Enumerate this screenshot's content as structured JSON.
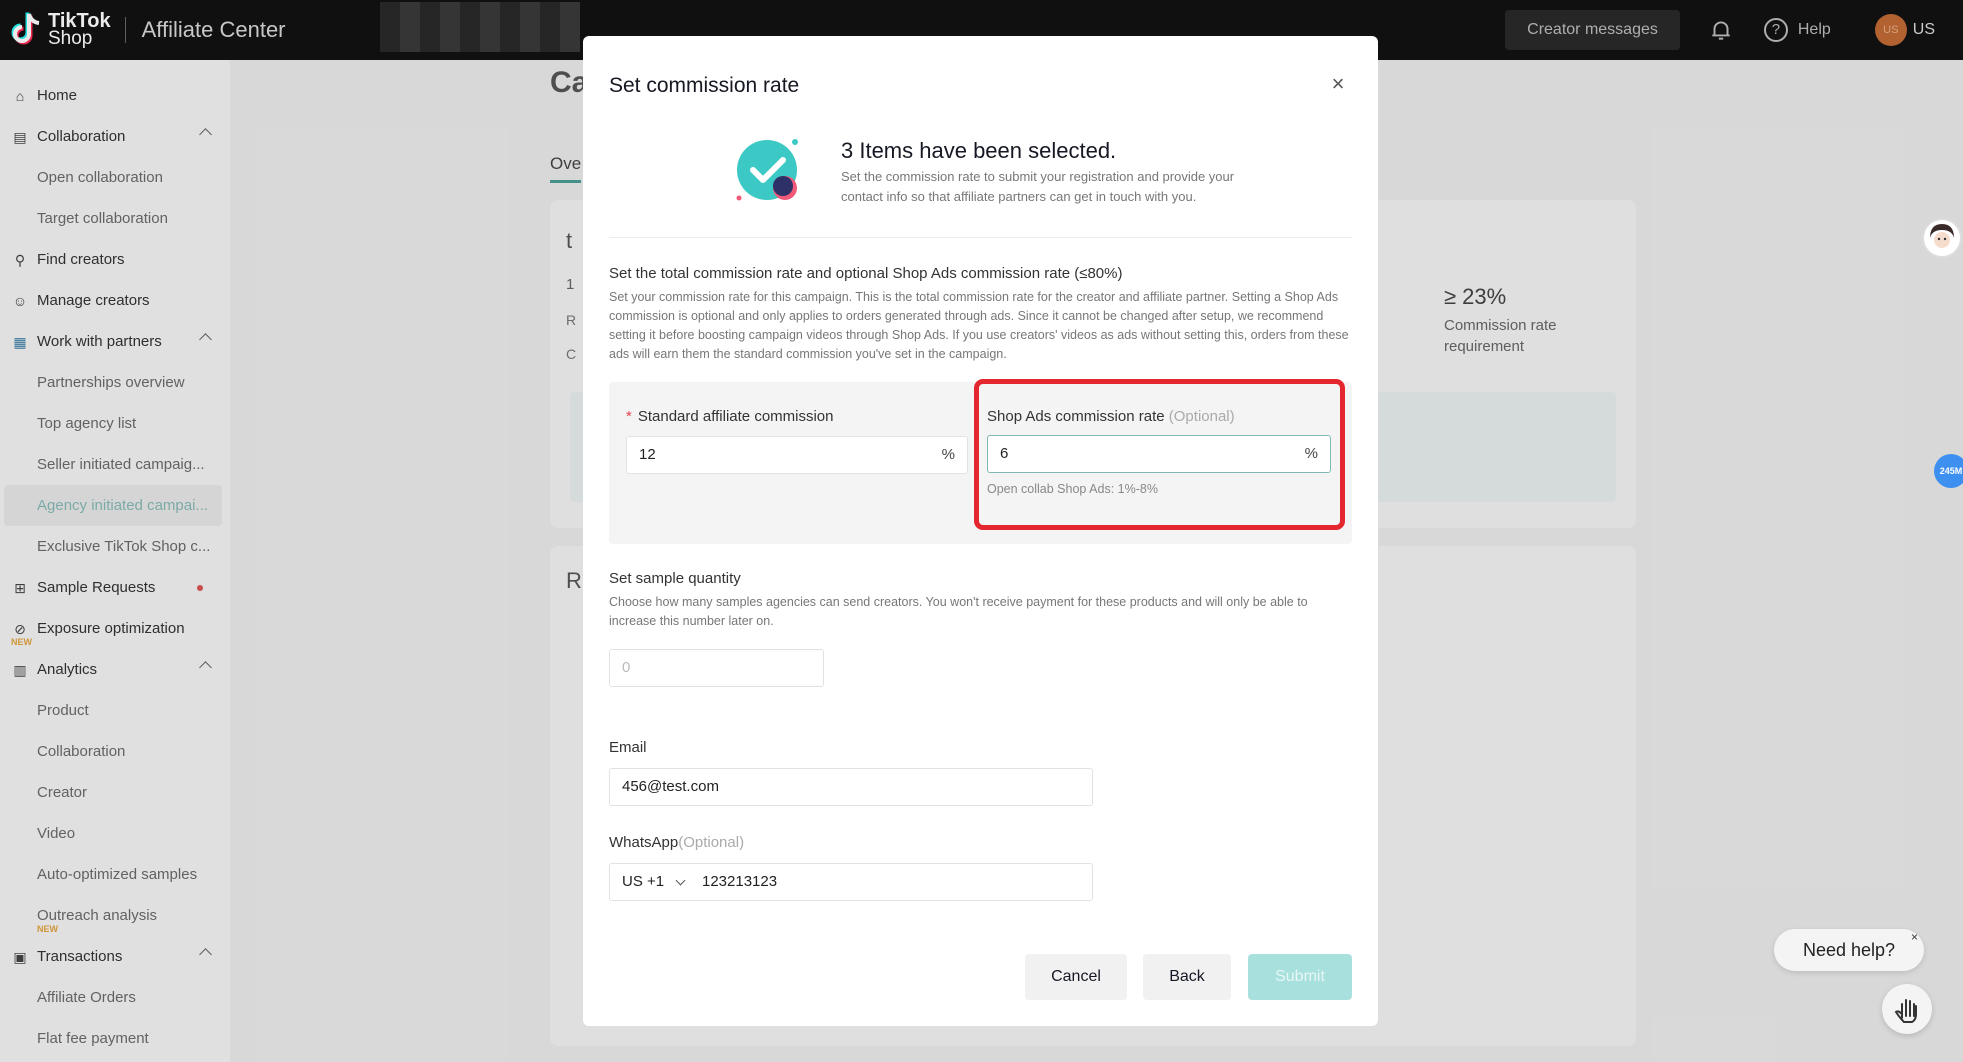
{
  "topbar": {
    "logo_line1": "TikTok",
    "logo_line2": "Shop",
    "app_title": "Affiliate Center",
    "creator_messages": "Creator messages",
    "help": "Help",
    "user_region": "US",
    "avatar_text": "US"
  },
  "sidebar": {
    "home": "Home",
    "collaboration": "Collaboration",
    "open_collaboration": "Open collaboration",
    "target_collaboration": "Target collaboration",
    "find_creators": "Find creators",
    "manage_creators": "Manage creators",
    "work_with_partners": "Work with partners",
    "partnerships_overview": "Partnerships overview",
    "top_agency_list": "Top agency list",
    "seller_initiated": "Seller initiated campaig...",
    "agency_initiated": "Agency initiated campai...",
    "exclusive_tiktok": "Exclusive TikTok Shop c...",
    "sample_requests": "Sample Requests",
    "exposure_optimization": "Exposure optimization",
    "new_badge": "NEW",
    "analytics": "Analytics",
    "product": "Product",
    "collaboration_an": "Collaboration",
    "creator": "Creator",
    "video": "Video",
    "auto_optimized": "Auto-optimized samples",
    "outreach_analysis": "Outreach analysis",
    "transactions": "Transactions",
    "affiliate_orders": "Affiliate Orders",
    "flat_fee_payment": "Flat fee payment"
  },
  "background": {
    "title_fragment": "Ca",
    "tab_fragment": "Ove",
    "card_letter": "t",
    "card_num": "1",
    "card_r": "R",
    "card_c": "C",
    "section_r": "R",
    "stat_value": "≥ 23%",
    "stat_label": "Commission rate requirement"
  },
  "modal": {
    "title": "Set commission rate",
    "hero_title": "3 Items have been selected.",
    "hero_desc": "Set the commission rate to submit your registration and provide your contact info so that affiliate partners can get in touch with you.",
    "commission_section_title": "Set the total commission rate and optional Shop Ads commission rate (≤80%)",
    "commission_section_desc": "Set your commission rate for this campaign. This is the total commission rate for the creator and affiliate partner. Setting a Shop Ads commission is optional and only applies to orders generated through ads. Since it cannot be changed after setup, we recommend setting it before boosting campaign videos through Shop Ads. If you use creators' videos as ads without setting this, orders from these ads will earn them the standard commission you've set in the campaign.",
    "standard_label": "Standard affiliate commission",
    "required_mark": "*",
    "standard_value": "12",
    "percent": "%",
    "shop_ads_label": "Shop Ads commission rate",
    "optional_text": "(Optional)",
    "shop_ads_value": "6",
    "shop_ads_hint": "Open collab Shop Ads: 1%-8%",
    "sample_title": "Set sample quantity",
    "sample_desc": "Choose how many samples agencies can send creators. You won't receive payment for these products and will only be able to increase this number later on.",
    "sample_placeholder": "0",
    "email_label": "Email",
    "email_value": "456@test.com",
    "whatsapp_label": "WhatsApp",
    "whatsapp_code": "US +1",
    "whatsapp_value": "123213123",
    "cancel": "Cancel",
    "back": "Back",
    "submit": "Submit"
  },
  "widgets": {
    "badge_text": "245M",
    "need_help": "Need help?",
    "close": "×"
  },
  "colors": {
    "accent": "#4a9e98",
    "submit_disabled": "#a8e0dd",
    "highlight": "#e4272f"
  }
}
